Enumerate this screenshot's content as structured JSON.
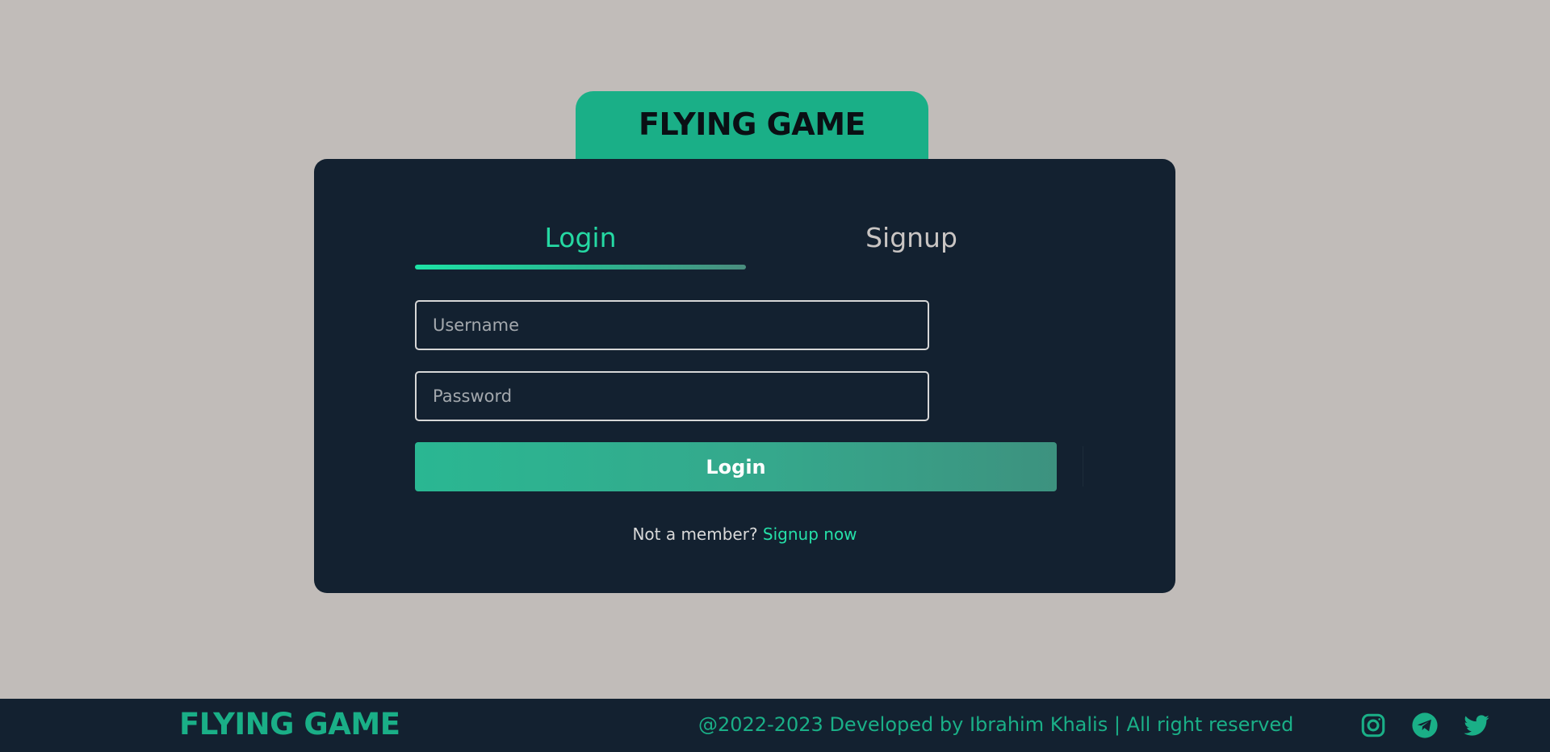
{
  "brand": {
    "title": "FLYING GAME"
  },
  "tabs": {
    "login": "Login",
    "signup": "Signup"
  },
  "form": {
    "username_placeholder": "Username",
    "password_placeholder": "Password",
    "submit_label": "Login"
  },
  "member": {
    "prompt": "Not a member?",
    "link": "Signup now"
  },
  "footer": {
    "brand": "FLYING GAME",
    "copyright": "@2022-2023 Developed by Ibrahim Khalis | All right reserved",
    "icons": [
      "instagram-icon",
      "telegram-icon",
      "twitter-icon"
    ]
  },
  "colors": {
    "background": "#c1bcb9",
    "panel": "#132130",
    "accent": "#1aaf87",
    "accent_bright": "#25d9a3"
  }
}
